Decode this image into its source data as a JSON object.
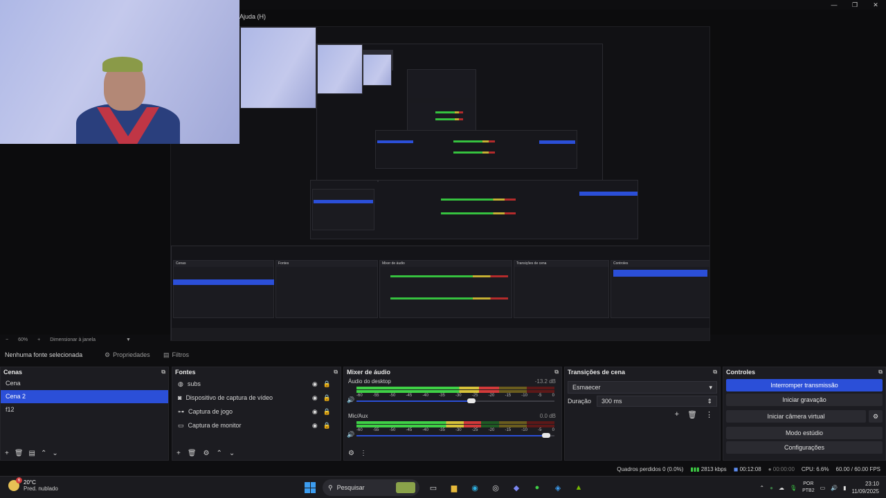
{
  "menu": {
    "help": "Ajuda (H)"
  },
  "window_buttons": [
    "—",
    "❐",
    "✕"
  ],
  "zoombar": {
    "minus": "−",
    "zoom": "60%",
    "plus": "+",
    "mode": "Dimensionar à janela"
  },
  "propbar": {
    "no_source": "Nenhuma fonte selecionada",
    "properties": "Propriedades",
    "filters": "Filtros"
  },
  "scenes": {
    "title": "Cenas",
    "items": [
      {
        "label": "Cena",
        "selected": false
      },
      {
        "label": "Cena 2",
        "selected": true
      },
      {
        "label": "f12",
        "selected": false
      }
    ]
  },
  "sources": {
    "title": "Fontes",
    "items": [
      {
        "label": "subs",
        "icon": "globe-icon"
      },
      {
        "label": "Dispositivo de captura de vídeo",
        "icon": "camera-icon"
      },
      {
        "label": "Captura de jogo",
        "icon": "gamepad-icon"
      },
      {
        "label": "Captura de monitor",
        "icon": "monitor-icon"
      }
    ]
  },
  "mixer": {
    "title": "Mixer de áudio",
    "ticks": [
      "-60",
      "-55",
      "-50",
      "-45",
      "-40",
      "-35",
      "-30",
      "-25",
      "-20",
      "-15",
      "-10",
      "-5",
      "0"
    ],
    "channels": [
      {
        "name": "Áudio do desktop",
        "db": "-13.2 dB",
        "level": 0.72,
        "volume": 0.6
      },
      {
        "name": "Mic/Aux",
        "db": "0.0 dB",
        "level": 0.63,
        "volume": 0.98
      }
    ]
  },
  "transitions": {
    "title": "Transições de cena",
    "selected": "Esmaecer",
    "duration_label": "Duração",
    "duration_value": "300 ms"
  },
  "controls": {
    "title": "Controles",
    "stop_stream": "Interromper transmissão",
    "start_record": "Iniciar gravação",
    "virtual_cam": "Iniciar câmera virtual",
    "studio_mode": "Modo estúdio",
    "settings": "Configurações"
  },
  "status": {
    "dropped": "Quadros perdidos 0 (0.0%)",
    "kbps": "2813 kbps",
    "stream_time": "00:12:08",
    "rec_time": "00:00:00",
    "cpu": "CPU: 6.6%",
    "fps": "60.00 / 60.00 FPS"
  },
  "taskbar": {
    "weather_badge": "6",
    "temp": "20°C",
    "weather": "Pred. nublado",
    "search": "Pesquisar",
    "lang1": "POR",
    "lang2": "PTB2",
    "time": "23:10",
    "date": "11/09/2025"
  },
  "colors": {
    "accent": "#2b4fd8",
    "meter_green": "#3fd146",
    "meter_yellow": "#d7c23a",
    "meter_red": "#d23a3a"
  }
}
